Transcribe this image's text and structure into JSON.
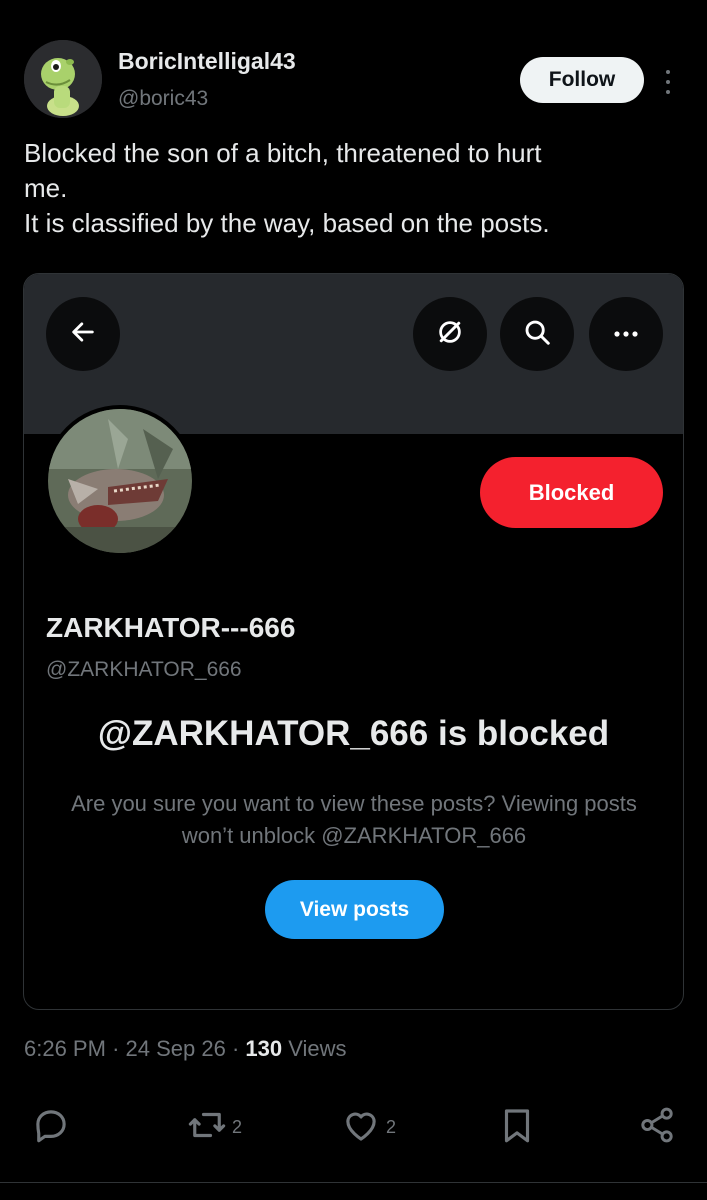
{
  "post": {
    "author_name": "BoricIntelligal43",
    "author_handle": "@boric43",
    "follow_label": "Follow",
    "text_lines": [
      "Blocked the son of a bitch, threatened to hurt",
      "me.",
      "It is classified by the way, based on the posts."
    ],
    "time": "6:26 PM",
    "date": "24 Sep 26",
    "separator": "·",
    "views_count": "130",
    "views_label": "Views"
  },
  "embedded_profile": {
    "back_icon": "arrow-left-icon",
    "grok_icon": "grok-slash-icon",
    "search_icon": "search-icon",
    "more_icon": "more-horizontal-icon",
    "blocked_label": "Blocked",
    "display_name": "ZARKHATOR---666",
    "handle": "@ZARKHATOR_666",
    "blocked_title": "@ZARKHATOR_666 is blocked",
    "blocked_message": "Are you sure you want to view these posts? Viewing posts won’t unblock @ZARKHATOR_666",
    "view_posts_label": "View posts"
  },
  "actions": {
    "reply_icon": "reply-icon",
    "repost_icon": "repost-icon",
    "repost_count": "2",
    "like_icon": "heart-icon",
    "like_count": "2",
    "bookmark_icon": "bookmark-icon",
    "share_icon": "share-icon"
  },
  "colors": {
    "background": "#000000",
    "text_primary": "#e7e9ea",
    "text_secondary": "#71767b",
    "blocked_red": "#f4212e",
    "view_posts_blue": "#1d9bf0",
    "follow_bg": "#eff3f4",
    "banner": "#26292d"
  }
}
